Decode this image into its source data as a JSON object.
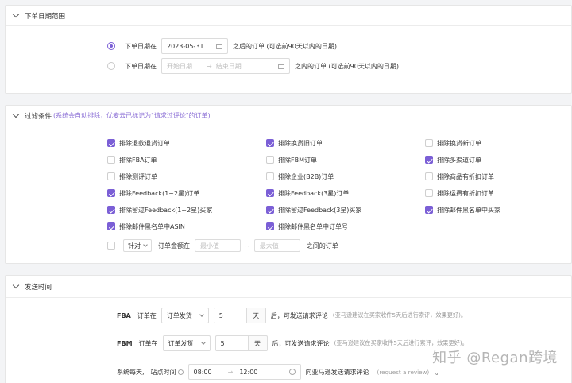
{
  "date_section": {
    "title": "下单日期范围",
    "row1": {
      "label": "下单日期在",
      "date": "2023-05-31",
      "suffix": "之后的订单 (可选前90天以内的日期)"
    },
    "row2": {
      "label": "下单日期在",
      "start_placeholder": "开始日期",
      "arrow": "→",
      "end_placeholder": "结束日期",
      "suffix": "之内的订单 (可选前90天以内的日期)"
    }
  },
  "filter_section": {
    "title": "过滤条件",
    "hint": "(系统会自动排除，优麦云已标记为\"请求过评论\"的订单)",
    "options": [
      {
        "label": "排除退款退货订单",
        "checked": true
      },
      {
        "label": "排除换货旧订单",
        "checked": true
      },
      {
        "label": "排除换货新订单",
        "checked": false
      },
      {
        "label": "排除FBA订单",
        "checked": false
      },
      {
        "label": "排除FBM订单",
        "checked": false
      },
      {
        "label": "排除多渠道订单",
        "checked": true
      },
      {
        "label": "排除测评订单",
        "checked": false
      },
      {
        "label": "排除企业(B2B)订单",
        "checked": false
      },
      {
        "label": "排除商品有折扣订单",
        "checked": false
      },
      {
        "label": "排除Feedback(1~2星)订单",
        "checked": true
      },
      {
        "label": "排除Feedback(3星)订单",
        "checked": true
      },
      {
        "label": "排除运费有折扣订单",
        "checked": false
      },
      {
        "label": "排除留过Feedback(1~2星)买家",
        "checked": true
      },
      {
        "label": "排除留过Feedback(3星)买家",
        "checked": true
      },
      {
        "label": "排除邮件黑名单中买家",
        "checked": true
      },
      {
        "label": "排除邮件黑名单中ASIN",
        "checked": true
      },
      {
        "label": "排除邮件黑名单中订单号",
        "checked": true
      }
    ],
    "amount_row": {
      "select": "针对",
      "label": "订单金额在",
      "min_placeholder": "最小值",
      "tilde": "~",
      "max_placeholder": "最大值",
      "suffix": "之间的订单"
    }
  },
  "send_section": {
    "title": "发送时间",
    "fba": {
      "tag": "FBA",
      "label": "订单在",
      "select": "订单发货",
      "value": "5",
      "unit": "天",
      "suffix": "后，可发送请求评论",
      "hint": "(亚马逊建议在买家收件5天后进行索评，效果更好)。"
    },
    "fbm": {
      "tag": "FBM",
      "label": "订单在",
      "select": "订单发货",
      "value": "5",
      "unit": "天",
      "suffix": "后，可发送请求评论",
      "hint": "(亚马逊建议在买家收件5天后进行索评，效果更好)。"
    },
    "daily": {
      "label": "系统每天,",
      "site_label": "站点时间",
      "start": "08:00",
      "arrow": "→",
      "end": "12:00",
      "suffix": "向亚马逊发送请求评论",
      "hint": "(request a review)",
      "end_mark": "。"
    }
  },
  "watermark": "知乎 @Regan跨境"
}
